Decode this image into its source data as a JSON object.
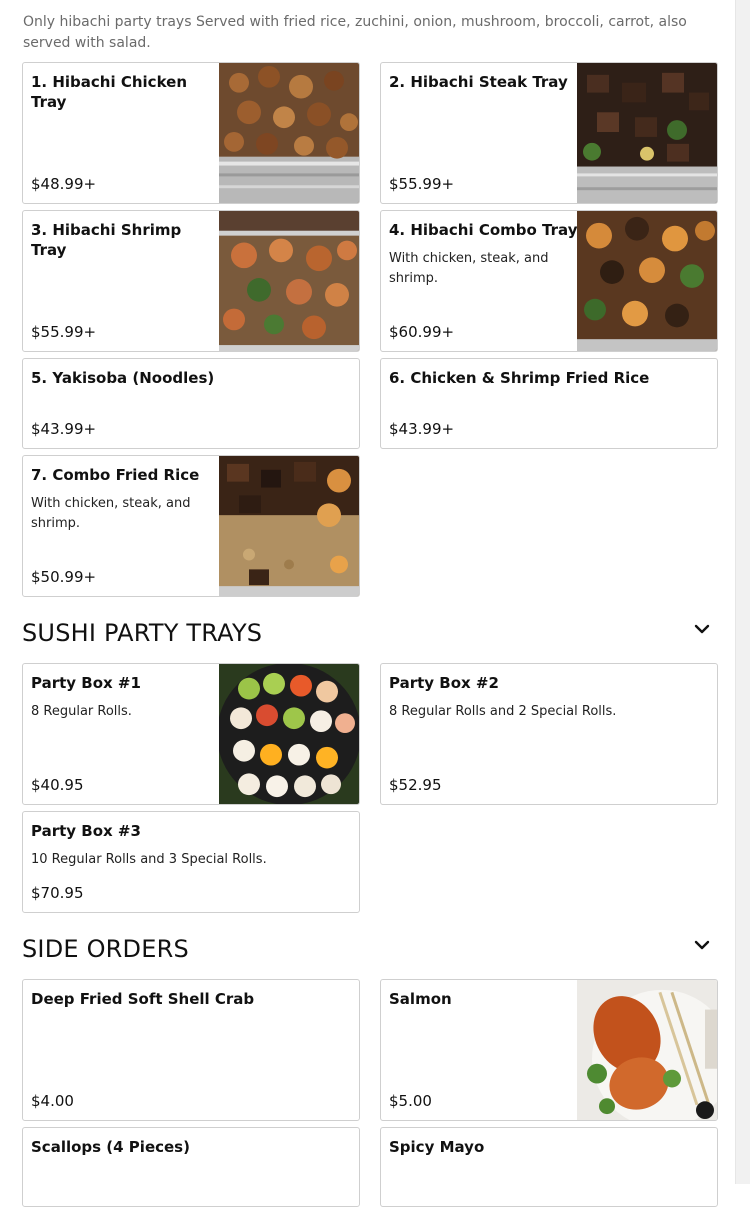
{
  "hibachi": {
    "description": "Only hibachi party trays Served with fried rice, zuchini, onion, mushroom, broccoli, carrot, also served with salad.",
    "items": [
      {
        "name": "1. Hibachi Chicken Tray",
        "price": "$48.99+"
      },
      {
        "name": "2. Hibachi Steak Tray",
        "price": "$55.99+"
      },
      {
        "name": "3. Hibachi Shrimp Tray",
        "price": "$55.99+"
      },
      {
        "name": "4. Hibachi Combo Tray",
        "desc": "With chicken, steak, and shrimp.",
        "price": "$60.99+"
      },
      {
        "name": "5. Yakisoba (Noodles)",
        "price": "$43.99+"
      },
      {
        "name": "6. Chicken & Shrimp Fried Rice",
        "price": "$43.99+"
      },
      {
        "name": "7. Combo Fried Rice",
        "desc": "With chicken, steak, and shrimp.",
        "price": "$50.99+"
      }
    ]
  },
  "sushi": {
    "title": "SUSHI PARTY TRAYS",
    "items": [
      {
        "name": "Party Box #1",
        "desc": "8 Regular Rolls.",
        "price": "$40.95"
      },
      {
        "name": "Party Box #2",
        "desc": "8 Regular Rolls and 2 Special Rolls.",
        "price": "$52.95"
      },
      {
        "name": "Party Box #3",
        "desc": "10 Regular Rolls and 3 Special Rolls.",
        "price": "$70.95"
      }
    ]
  },
  "sides": {
    "title": "SIDE ORDERS",
    "items": [
      {
        "name": "Deep Fried Soft Shell Crab",
        "price": "$4.00"
      },
      {
        "name": "Salmon",
        "price": "$5.00"
      },
      {
        "name": "Scallops (4 Pieces)"
      },
      {
        "name": "Spicy Mayo"
      }
    ]
  },
  "icons": {
    "expand": "chevron-down-icon"
  }
}
